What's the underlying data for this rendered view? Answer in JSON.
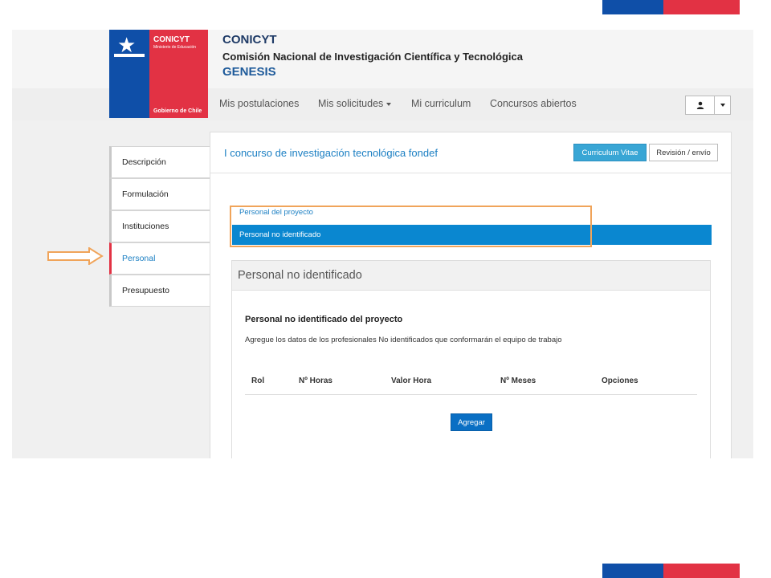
{
  "brand": {
    "logo_name": "CONICYT",
    "logo_subtitle": "Ministerio de Educación",
    "logo_footer": "Gobierno de Chile",
    "title": "CONICYT",
    "subtitle": "Comisión Nacional de Investigación Científica y Tecnológica",
    "app": "GENESIS"
  },
  "nav": {
    "items": [
      "Mis postulaciones",
      "Mis solicitudes",
      "Mi curriculum",
      "Concursos abiertos"
    ]
  },
  "user_menu": {
    "icon": "user-icon"
  },
  "sidebar": {
    "items": [
      {
        "label": "Descripción"
      },
      {
        "label": "Formulación"
      },
      {
        "label": "Instituciones"
      },
      {
        "label": "Personal"
      },
      {
        "label": "Presupuesto"
      }
    ],
    "active": "Personal"
  },
  "main": {
    "title": "I concurso de investigación tecnológica fondef",
    "btn_cv": "Curriculum Vitae",
    "btn_review": "Revisión / envío",
    "subnav": {
      "link": "Personal del proyecto",
      "active": "Personal no identificado"
    },
    "panel": {
      "heading": "Personal no identificado",
      "title": "Personal no identificado del proyecto",
      "description": "Agregue los datos de los profesionales No identificados que conformarán el equipo de trabajo",
      "columns": [
        "Rol",
        "Nº Horas",
        "Valor Hora",
        "Nº Meses",
        "Opciones"
      ],
      "add_button": "Agregar"
    }
  },
  "colors": {
    "flag_blue": "#0f4fa8",
    "flag_red": "#e23244",
    "link_blue": "#1b7fc3",
    "highlight_orange": "#f0a45a"
  }
}
